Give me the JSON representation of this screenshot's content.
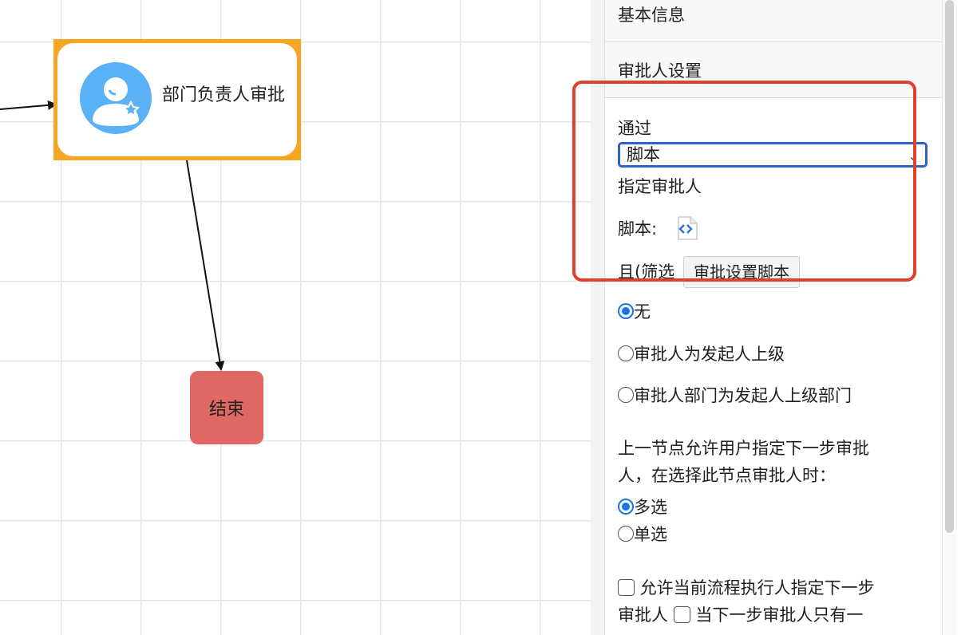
{
  "canvas": {
    "task_node": {
      "title": "部门负责人审批"
    },
    "end_node": {
      "title": "结束"
    }
  },
  "panel": {
    "basic_info_heading": "基本信息",
    "approver_settings_heading": "审批人设置",
    "pass_label": "通过",
    "pass_select": {
      "selected": "脚本"
    },
    "assign_approver_label": "指定审批人",
    "script_label": "脚本:",
    "script_tooltip": "审批设置脚本",
    "and_filter_label": "且(筛选",
    "filter_options": [
      {
        "label": "无",
        "checked": true
      },
      {
        "label": " 审批人为发起人上级",
        "checked": false
      },
      {
        "label": "审批人部门为发起人上级部门",
        "checked": false
      }
    ],
    "prev_node_text_line1": "上一节点允许用户指定下一步审批",
    "prev_node_text_line2": "人，在选择此节点审批人时：",
    "select_mode_options": [
      {
        "label": "多选",
        "checked": true
      },
      {
        "label": "单选",
        "checked": false
      }
    ],
    "allow_exec_text_line1": " 允许当前流程执行人指定下一步",
    "allow_exec_text_line2a": "审批人 ",
    "allow_exec_text_line2b": " 当下一步审批人只有一"
  },
  "colors": {
    "task_border": "#f5a623",
    "avatar": "#5bb1f7",
    "end_node": "#e06864",
    "highlight": "#e2402f",
    "select_border": "#2a64c8",
    "radio_checked": "#1a73e8"
  }
}
